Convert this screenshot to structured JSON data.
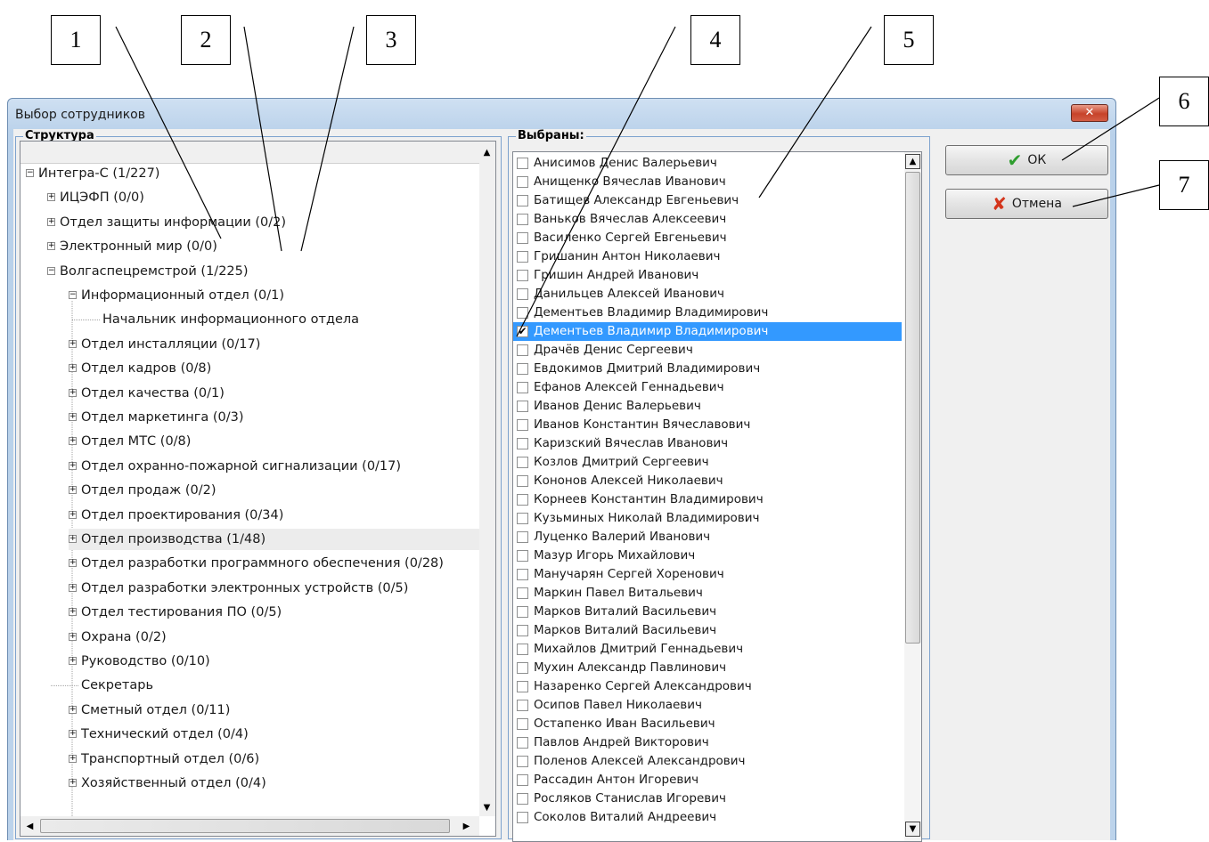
{
  "callouts": [
    "1",
    "2",
    "3",
    "4",
    "5",
    "6",
    "7"
  ],
  "window": {
    "title": "Выбор сотрудников",
    "close_glyph": "✕"
  },
  "structure": {
    "caption": "Структура",
    "nodes": [
      {
        "label": "Интегра-С (1/227)",
        "toggle": "−"
      },
      {
        "label": "ИЦЭФП (0/0)",
        "toggle": "+"
      },
      {
        "label": "Отдел  защиты информации (0/2)",
        "toggle": "+"
      },
      {
        "label": "Электронный мир (0/0)",
        "toggle": "+"
      },
      {
        "label": "Волгаспецремстрой (1/225)",
        "toggle": "−"
      },
      {
        "label": "Информационный отдел (0/1)",
        "toggle": "−"
      },
      {
        "label": "Начальник информационного отдела",
        "toggle": ""
      },
      {
        "label": "Отдел инсталляции (0/17)",
        "toggle": "+"
      },
      {
        "label": "Отдел кадров (0/8)",
        "toggle": "+"
      },
      {
        "label": "Отдел качества (0/1)",
        "toggle": "+"
      },
      {
        "label": "Отдел маркетинга (0/3)",
        "toggle": "+"
      },
      {
        "label": "Отдел МТС (0/8)",
        "toggle": "+"
      },
      {
        "label": "Отдел охранно-пожарной сигнализации (0/17)",
        "toggle": "+"
      },
      {
        "label": "Отдел продаж (0/2)",
        "toggle": "+"
      },
      {
        "label": "Отдел проектирования (0/34)",
        "toggle": "+"
      },
      {
        "label": "Отдел производства (1/48)",
        "toggle": "+"
      },
      {
        "label": "Отдел разработки программного обеспечения (0/28)",
        "toggle": "+"
      },
      {
        "label": "Отдел разработки электронных устройств (0/5)",
        "toggle": "+"
      },
      {
        "label": "Отдел тестирования ПО (0/5)",
        "toggle": "+"
      },
      {
        "label": "Охрана (0/2)",
        "toggle": "+"
      },
      {
        "label": "Руководство (0/10)",
        "toggle": "+"
      },
      {
        "label": "Секретарь",
        "toggle": ""
      },
      {
        "label": "Сметный отдел (0/11)",
        "toggle": "+"
      },
      {
        "label": "Технический отдел (0/4)",
        "toggle": "+"
      },
      {
        "label": "Транспортный  отдел (0/6)",
        "toggle": "+"
      },
      {
        "label": "Хозяйственный  отдел (0/4)",
        "toggle": "+"
      }
    ],
    "selected_node": "Отдел производства (1/48)"
  },
  "selected": {
    "caption": "Выбраны:",
    "items": [
      {
        "name": "Анисимов Денис Валерьевич",
        "checked": false
      },
      {
        "name": "Анищенко Вячеслав Иванович",
        "checked": false
      },
      {
        "name": "Батищев Александр Евгеньевич",
        "checked": false
      },
      {
        "name": "Ваньков Вячеслав Алексеевич",
        "checked": false
      },
      {
        "name": "Василенко Сергей Евгеньевич",
        "checked": false
      },
      {
        "name": "Гришанин Антон Николаевич",
        "checked": false
      },
      {
        "name": "Гришин Андрей Иванович",
        "checked": false
      },
      {
        "name": "Данильцев Алексей Иванович",
        "checked": false
      },
      {
        "name": "Дементьев Владимир Владимирович",
        "checked": false
      },
      {
        "name": "Дементьев Владимир Владимирович",
        "checked": true
      },
      {
        "name": "Драчёв Денис Сергеевич",
        "checked": false
      },
      {
        "name": "Евдокимов Дмитрий Владимирович",
        "checked": false
      },
      {
        "name": "Ефанов Алексей Геннадьевич",
        "checked": false
      },
      {
        "name": "Иванов Денис Валерьевич",
        "checked": false
      },
      {
        "name": "Иванов Константин Вячеславович",
        "checked": false
      },
      {
        "name": "Каризский Вячеслав Иванович",
        "checked": false
      },
      {
        "name": "Козлов Дмитрий  Сергеевич",
        "checked": false
      },
      {
        "name": "Кононов Алексей Николаевич",
        "checked": false
      },
      {
        "name": "Корнеев Константин Владимирович",
        "checked": false
      },
      {
        "name": "Кузьминых Николай Владимирович",
        "checked": false
      },
      {
        "name": "Луценко Валерий Иванович",
        "checked": false
      },
      {
        "name": "Мазур Игорь Михайлович",
        "checked": false
      },
      {
        "name": "Манучарян Сергей Хоренович",
        "checked": false
      },
      {
        "name": "Маркин Павел Витальевич",
        "checked": false
      },
      {
        "name": "Марков Виталий Васильевич",
        "checked": false
      },
      {
        "name": "Марков Виталий Васильевич",
        "checked": false
      },
      {
        "name": "Михайлов Дмитрий  Геннадьевич",
        "checked": false
      },
      {
        "name": "Мухин Александр Павлинович",
        "checked": false
      },
      {
        "name": "Назаренко Сергей Александрович",
        "checked": false
      },
      {
        "name": "Осипов Павел Николаевич",
        "checked": false
      },
      {
        "name": "Остапенко Иван Васильевич",
        "checked": false
      },
      {
        "name": "Павлов Андрей Викторович",
        "checked": false
      },
      {
        "name": "Поленов Алексей Александрович",
        "checked": false
      },
      {
        "name": "Рассадин Антон Игоревич",
        "checked": false
      },
      {
        "name": "Росляков Станислав Игоревич",
        "checked": false
      },
      {
        "name": "Соколов Виталий Андреевич",
        "checked": false
      }
    ],
    "check_glyph": "✔",
    "selected_index": 9
  },
  "buttons": {
    "ok": {
      "label": "ОК",
      "icon": "checkmark-icon",
      "icon_glyph": "✔",
      "icon_color": "#2f9e2f"
    },
    "cancel": {
      "label": "Отмена",
      "icon": "cross-icon",
      "icon_glyph": "✘",
      "icon_color": "#d4351c"
    }
  },
  "colors": {
    "selection": "#3399ff",
    "title_gradient": "#b9d1ea"
  }
}
